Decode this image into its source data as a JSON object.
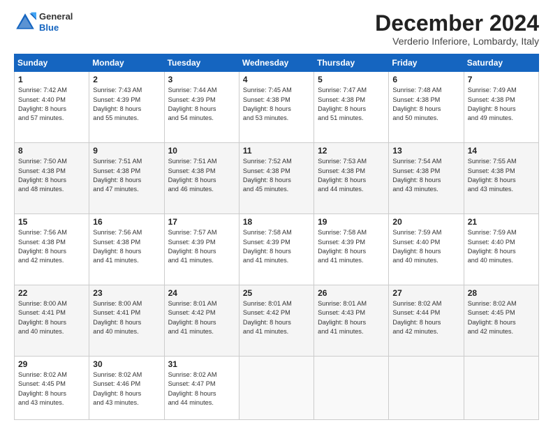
{
  "header": {
    "logo": {
      "general": "General",
      "blue": "Blue"
    },
    "title": "December 2024",
    "location": "Verderio Inferiore, Lombardy, Italy"
  },
  "weekdays": [
    "Sunday",
    "Monday",
    "Tuesday",
    "Wednesday",
    "Thursday",
    "Friday",
    "Saturday"
  ],
  "weeks": [
    [
      {
        "day": "1",
        "info": "Sunrise: 7:42 AM\nSunset: 4:40 PM\nDaylight: 8 hours\nand 57 minutes."
      },
      {
        "day": "2",
        "info": "Sunrise: 7:43 AM\nSunset: 4:39 PM\nDaylight: 8 hours\nand 55 minutes."
      },
      {
        "day": "3",
        "info": "Sunrise: 7:44 AM\nSunset: 4:39 PM\nDaylight: 8 hours\nand 54 minutes."
      },
      {
        "day": "4",
        "info": "Sunrise: 7:45 AM\nSunset: 4:38 PM\nDaylight: 8 hours\nand 53 minutes."
      },
      {
        "day": "5",
        "info": "Sunrise: 7:47 AM\nSunset: 4:38 PM\nDaylight: 8 hours\nand 51 minutes."
      },
      {
        "day": "6",
        "info": "Sunrise: 7:48 AM\nSunset: 4:38 PM\nDaylight: 8 hours\nand 50 minutes."
      },
      {
        "day": "7",
        "info": "Sunrise: 7:49 AM\nSunset: 4:38 PM\nDaylight: 8 hours\nand 49 minutes."
      }
    ],
    [
      {
        "day": "8",
        "info": "Sunrise: 7:50 AM\nSunset: 4:38 PM\nDaylight: 8 hours\nand 48 minutes."
      },
      {
        "day": "9",
        "info": "Sunrise: 7:51 AM\nSunset: 4:38 PM\nDaylight: 8 hours\nand 47 minutes."
      },
      {
        "day": "10",
        "info": "Sunrise: 7:51 AM\nSunset: 4:38 PM\nDaylight: 8 hours\nand 46 minutes."
      },
      {
        "day": "11",
        "info": "Sunrise: 7:52 AM\nSunset: 4:38 PM\nDaylight: 8 hours\nand 45 minutes."
      },
      {
        "day": "12",
        "info": "Sunrise: 7:53 AM\nSunset: 4:38 PM\nDaylight: 8 hours\nand 44 minutes."
      },
      {
        "day": "13",
        "info": "Sunrise: 7:54 AM\nSunset: 4:38 PM\nDaylight: 8 hours\nand 43 minutes."
      },
      {
        "day": "14",
        "info": "Sunrise: 7:55 AM\nSunset: 4:38 PM\nDaylight: 8 hours\nand 43 minutes."
      }
    ],
    [
      {
        "day": "15",
        "info": "Sunrise: 7:56 AM\nSunset: 4:38 PM\nDaylight: 8 hours\nand 42 minutes."
      },
      {
        "day": "16",
        "info": "Sunrise: 7:56 AM\nSunset: 4:38 PM\nDaylight: 8 hours\nand 41 minutes."
      },
      {
        "day": "17",
        "info": "Sunrise: 7:57 AM\nSunset: 4:39 PM\nDaylight: 8 hours\nand 41 minutes."
      },
      {
        "day": "18",
        "info": "Sunrise: 7:58 AM\nSunset: 4:39 PM\nDaylight: 8 hours\nand 41 minutes."
      },
      {
        "day": "19",
        "info": "Sunrise: 7:58 AM\nSunset: 4:39 PM\nDaylight: 8 hours\nand 41 minutes."
      },
      {
        "day": "20",
        "info": "Sunrise: 7:59 AM\nSunset: 4:40 PM\nDaylight: 8 hours\nand 40 minutes."
      },
      {
        "day": "21",
        "info": "Sunrise: 7:59 AM\nSunset: 4:40 PM\nDaylight: 8 hours\nand 40 minutes."
      }
    ],
    [
      {
        "day": "22",
        "info": "Sunrise: 8:00 AM\nSunset: 4:41 PM\nDaylight: 8 hours\nand 40 minutes."
      },
      {
        "day": "23",
        "info": "Sunrise: 8:00 AM\nSunset: 4:41 PM\nDaylight: 8 hours\nand 40 minutes."
      },
      {
        "day": "24",
        "info": "Sunrise: 8:01 AM\nSunset: 4:42 PM\nDaylight: 8 hours\nand 41 minutes."
      },
      {
        "day": "25",
        "info": "Sunrise: 8:01 AM\nSunset: 4:42 PM\nDaylight: 8 hours\nand 41 minutes."
      },
      {
        "day": "26",
        "info": "Sunrise: 8:01 AM\nSunset: 4:43 PM\nDaylight: 8 hours\nand 41 minutes."
      },
      {
        "day": "27",
        "info": "Sunrise: 8:02 AM\nSunset: 4:44 PM\nDaylight: 8 hours\nand 42 minutes."
      },
      {
        "day": "28",
        "info": "Sunrise: 8:02 AM\nSunset: 4:45 PM\nDaylight: 8 hours\nand 42 minutes."
      }
    ],
    [
      {
        "day": "29",
        "info": "Sunrise: 8:02 AM\nSunset: 4:45 PM\nDaylight: 8 hours\nand 43 minutes."
      },
      {
        "day": "30",
        "info": "Sunrise: 8:02 AM\nSunset: 4:46 PM\nDaylight: 8 hours\nand 43 minutes."
      },
      {
        "day": "31",
        "info": "Sunrise: 8:02 AM\nSunset: 4:47 PM\nDaylight: 8 hours\nand 44 minutes."
      },
      {
        "day": "",
        "info": ""
      },
      {
        "day": "",
        "info": ""
      },
      {
        "day": "",
        "info": ""
      },
      {
        "day": "",
        "info": ""
      }
    ]
  ]
}
